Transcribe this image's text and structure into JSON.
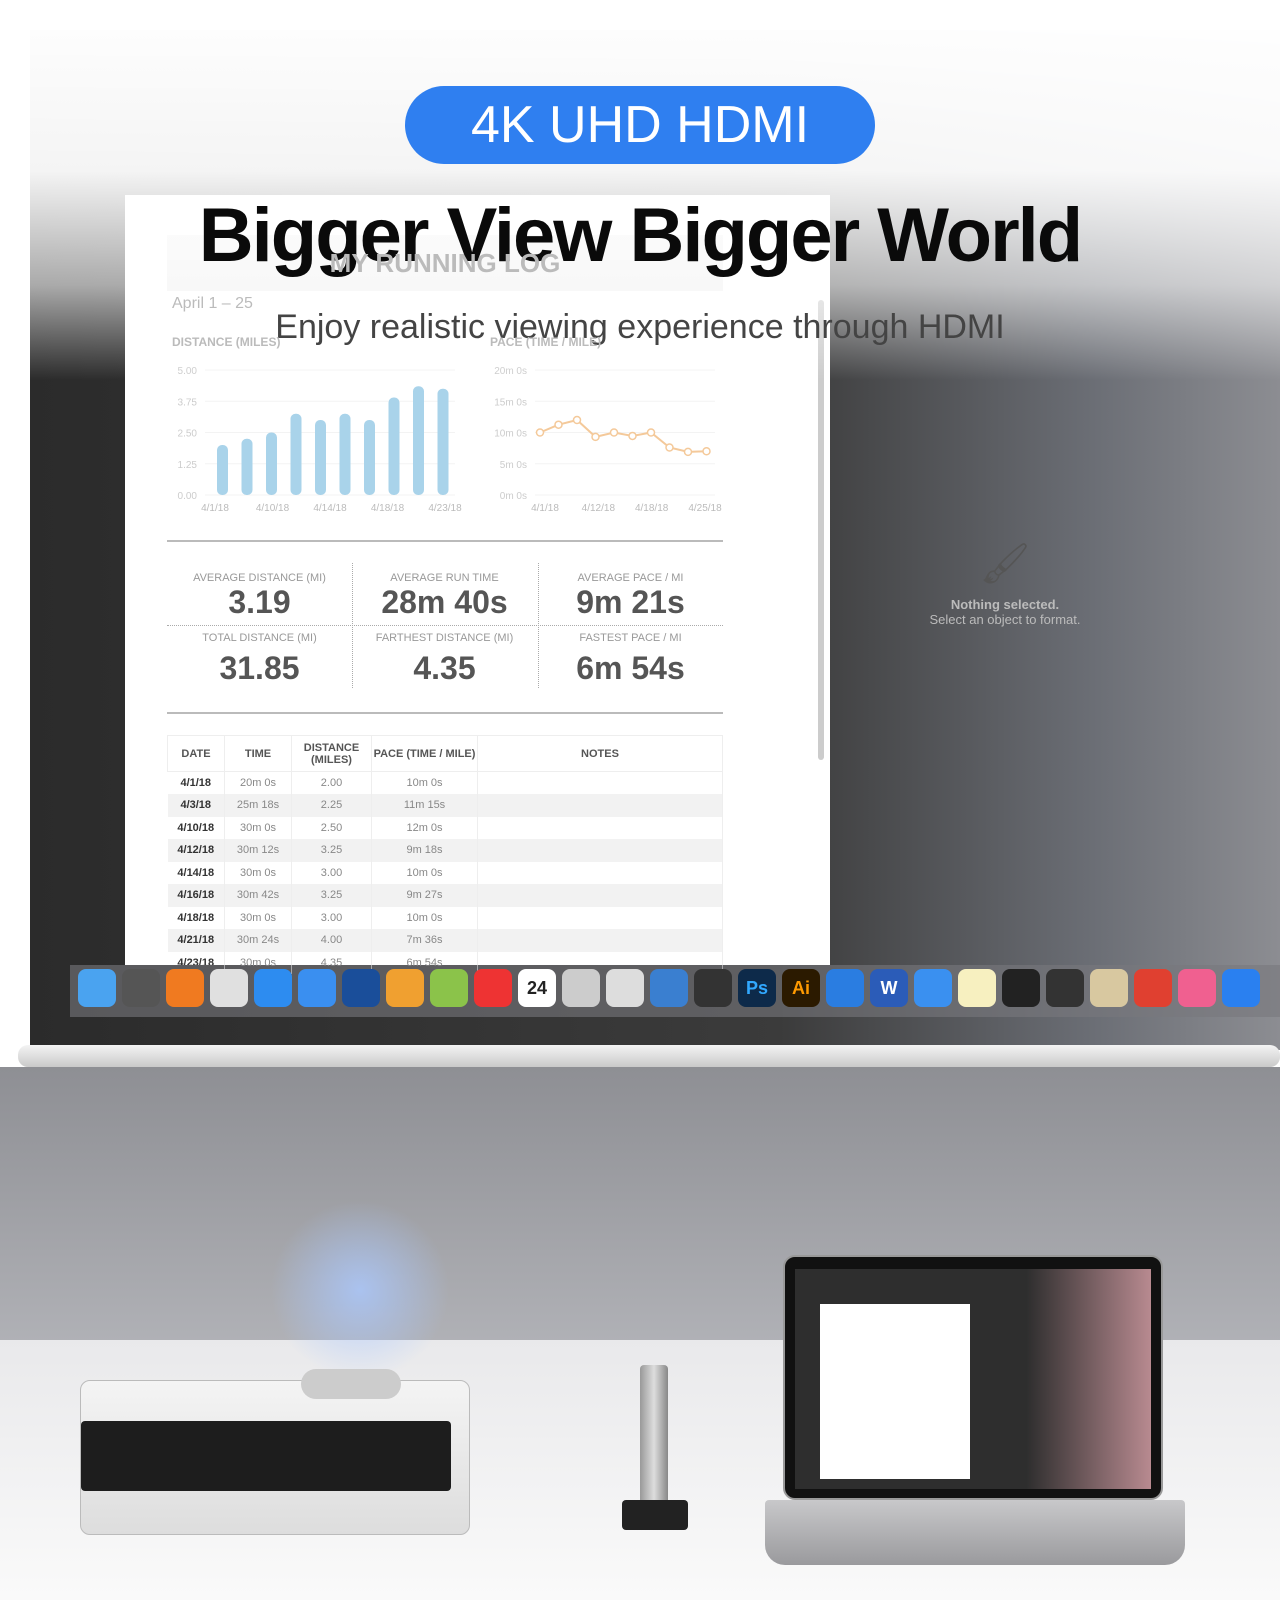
{
  "banner": {
    "badge": "4K UHD HDMI",
    "headline": "Bigger View  Bigger World",
    "subtitle": "Enjoy realistic viewing experience through HDMI"
  },
  "spreadsheet": {
    "title": "MY RUNNING LOG",
    "date_range": "April 1 – 25",
    "format_panel": {
      "line1": "Nothing selected.",
      "line2": "Select an object to format."
    },
    "stats": [
      {
        "label": "AVERAGE DISTANCE (MI)",
        "value": "3.19"
      },
      {
        "label": "AVERAGE RUN TIME",
        "value": "28m 40s"
      },
      {
        "label": "AVERAGE PACE / MI",
        "value": "9m 21s"
      },
      {
        "label": "TOTAL DISTANCE (MI)",
        "value": "31.85"
      },
      {
        "label": "FARTHEST DISTANCE (MI)",
        "value": "4.35"
      },
      {
        "label": "FASTEST PACE / MI",
        "value": "6m 54s"
      }
    ],
    "table": {
      "headers": [
        "DATE",
        "TIME",
        "DISTANCE (MILES)",
        "PACE (TIME / MILE)",
        "NOTES"
      ],
      "rows": [
        [
          "4/1/18",
          "20m 0s",
          "2.00",
          "10m 0s",
          ""
        ],
        [
          "4/3/18",
          "25m 18s",
          "2.25",
          "11m 15s",
          ""
        ],
        [
          "4/10/18",
          "30m 0s",
          "2.50",
          "12m 0s",
          ""
        ],
        [
          "4/12/18",
          "30m 12s",
          "3.25",
          "9m 18s",
          ""
        ],
        [
          "4/14/18",
          "30m 0s",
          "3.00",
          "10m 0s",
          ""
        ],
        [
          "4/16/18",
          "30m 42s",
          "3.25",
          "9m 27s",
          ""
        ],
        [
          "4/18/18",
          "30m 0s",
          "3.00",
          "10m 0s",
          ""
        ],
        [
          "4/21/18",
          "30m 24s",
          "4.00",
          "7m 36s",
          ""
        ],
        [
          "4/23/18",
          "30m 0s",
          "4.35",
          "6m 54s",
          ""
        ]
      ]
    }
  },
  "chart_data": [
    {
      "type": "bar",
      "title": "DISTANCE (MILES)",
      "ylim": [
        0,
        5
      ],
      "yticks": [
        "0.00",
        "1.25",
        "2.50",
        "3.75",
        "5.00"
      ],
      "xticks": [
        "4/1/18",
        "4/10/18",
        "4/14/18",
        "4/18/18",
        "4/23/18"
      ],
      "values": [
        2.0,
        2.25,
        2.5,
        3.25,
        3.0,
        3.25,
        3.0,
        3.9,
        4.35,
        4.25
      ],
      "color": "#a9d3ea"
    },
    {
      "type": "line",
      "title": "PACE (TIME / MILE)",
      "ylim": [
        0,
        20
      ],
      "yticks": [
        "0m 0s",
        "5m 0s",
        "10m 0s",
        "15m 0s",
        "20m 0s"
      ],
      "xticks": [
        "4/1/18",
        "4/12/18",
        "4/18/18",
        "4/25/18"
      ],
      "values": [
        10,
        11.25,
        12,
        9.3,
        10,
        9.45,
        10,
        7.6,
        6.9,
        7.0
      ],
      "color": "#f4c99a"
    }
  ],
  "dock": {
    "calendar_day": "24",
    "icons": [
      "finder-icon",
      "launchpad-icon",
      "firefox-icon",
      "chrome-icon",
      "safari-icon",
      "paw-icon",
      "scissors-icon",
      "sun-icon",
      "android-icon",
      "mic-icon",
      "calendar-icon",
      "screenshot-icon",
      "printer-icon",
      "intel-icon",
      "preview-icon",
      "photoshop-icon",
      "illustrator-icon",
      "aperture-icon",
      "word-icon",
      "pen-icon",
      "notes-icon",
      "terminal-icon",
      "dashboard-icon",
      "archive-icon",
      "bookmark-icon",
      "itunes-icon",
      "app-store-icon"
    ],
    "ps_label": "Ps",
    "ai_label": "Ai",
    "word_label": "W"
  }
}
